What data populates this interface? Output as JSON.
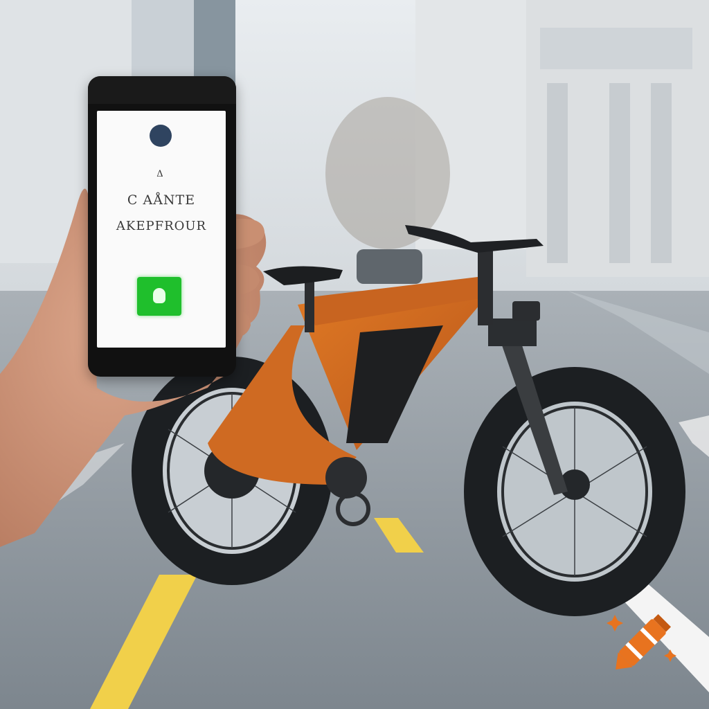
{
  "scene": {
    "description_colors": {
      "sky": "#e6eaee",
      "road": "#8f979f",
      "bike_frame": "#d26a1e",
      "tire": "#1c1f22",
      "lane_yellow": "#f1d04a",
      "lane_white": "#f4f4f4",
      "app_button": "#1fbf2c"
    }
  },
  "phone": {
    "screen_line1": "C AÅNTE",
    "screen_line2": "AKEPFROUR",
    "logo_glyph": "Δ"
  },
  "watermark": {
    "icon": "crayon-icon"
  }
}
